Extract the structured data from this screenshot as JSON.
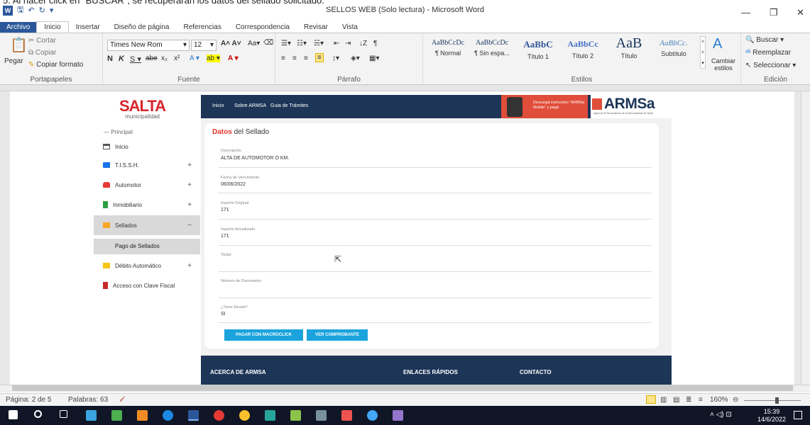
{
  "instruction_text": "5.  Al hacer click en \"BUSCAR\", se recuperarán los datos del sellado solicitado.",
  "window": {
    "title": "SELLOS WEB (Solo lectura) - Microsoft Word",
    "minimize": "—",
    "restore": "❐",
    "close": "✕"
  },
  "ribbon_tabs": [
    "Archivo",
    "Inicio",
    "Insertar",
    "Diseño de página",
    "Referencias",
    "Correspondencia",
    "Revisar",
    "Vista"
  ],
  "ribbon": {
    "clipboard": {
      "paste": "Pegar",
      "cut": "Cortar",
      "copy": "Copiar",
      "format_painter": "Copiar formato",
      "group": "Portapapeles"
    },
    "font": {
      "font_name": "Times New Rom",
      "font_size": "12",
      "group": "Fuente"
    },
    "paragraph": {
      "group": "Párrafo"
    },
    "styles": {
      "items": [
        {
          "preview": "AaBbCcDc",
          "name": "¶ Normal"
        },
        {
          "preview": "AaBbCcDc",
          "name": "¶ Sin espa..."
        },
        {
          "preview": "AaBbC",
          "name": "Título 1"
        },
        {
          "preview": "AaBbCc",
          "name": "Título 2"
        },
        {
          "preview": "AaB",
          "name": "Título"
        },
        {
          "preview": "AaBbCc.",
          "name": "Subtítulo"
        }
      ],
      "change_styles": "Cambiar estilos",
      "group": "Estilos"
    },
    "editing": {
      "find": "Buscar",
      "replace": "Reemplazar",
      "select": "Seleccionar",
      "group": "Edición"
    }
  },
  "site": {
    "logo": {
      "brand": "SALTA",
      "sub": "municipalidad"
    },
    "nav": [
      "Inicio",
      "Sobre ARMSA",
      "Guia de Trámites"
    ],
    "promo": "Descargá instructivo \"ARMSa Mobile\" y pagá",
    "armsa": {
      "word": "ARMSa",
      "sub": "Agencia de Recaudación de la Municipalidad de Salta"
    },
    "sidebar": {
      "section": "— Principal",
      "items": [
        {
          "label": "Inicio",
          "plus": ""
        },
        {
          "label": "T.I.S.S.H.",
          "plus": "+"
        },
        {
          "label": "Automotor",
          "plus": "+"
        },
        {
          "label": "Inmobiliario",
          "plus": "+"
        },
        {
          "label": "Sellados",
          "plus": "−"
        },
        {
          "label": "Débito Automático",
          "plus": "+"
        },
        {
          "label": "Acceso con Clave Fiscal",
          "plus": ""
        }
      ],
      "sub_item": "Pago de Sellados"
    },
    "card": {
      "title_highlight": "Datos",
      "title_rest": " del Sellado",
      "fields": [
        {
          "label": "Descripción",
          "value": "ALTA DE AUTOMOTOR O KM."
        },
        {
          "label": "Fecha de Vencimiento",
          "value": "06/06/2022"
        },
        {
          "label": "Importe Original",
          "value": "171"
        },
        {
          "label": "Importe Actualizado",
          "value": "171"
        },
        {
          "label": "Titular",
          "value": ""
        },
        {
          "label": "Número de Documento",
          "value": ""
        },
        {
          "label": "¿Tiene Deuda?",
          "value": "SI"
        }
      ],
      "buttons": [
        "PAGAR CON MACROCLICK",
        "VER COMPROBANTE"
      ]
    },
    "footer": [
      "ACERCA DE ARMSA",
      "ENLACES RÁPIDOS",
      "CONTACTO"
    ]
  },
  "status": {
    "page": "Página: 2 de 5",
    "words": "Palabras: 63",
    "zoom": "160%"
  },
  "taskbar": {
    "time": "15:39",
    "date": "14/6/2022"
  },
  "colors": {
    "word_blue": "#2b579a",
    "site_navy": "#1d3557",
    "salta_red": "#d6262c",
    "button_blue": "#1ba3dd"
  }
}
